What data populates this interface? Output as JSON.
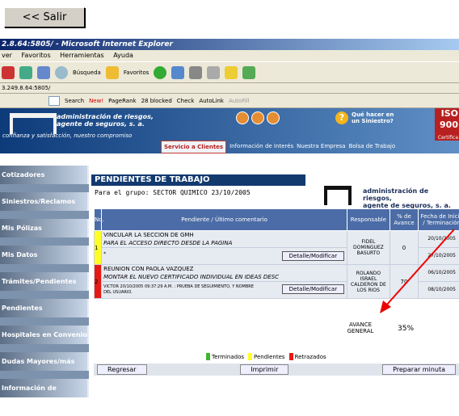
{
  "exit_button": "<< Salir",
  "window": {
    "title": "2.8.64:5805/ - Microsoft Internet Explorer",
    "menu": [
      "ver",
      "Favoritos",
      "Herramientas",
      "Ayuda"
    ],
    "toolbar": {
      "search": "Búsqueda",
      "favorites": "Favoritos"
    },
    "address": "3.249.8.64:5805/",
    "google": {
      "search": "Search",
      "new": "New!",
      "pagerank": "PageRank",
      "blocked": "28 blocked",
      "check": "Check",
      "autolink": "AutoLink",
      "autofill": "AutoFill"
    }
  },
  "site": {
    "brand_line1": "administración de riesgos,",
    "brand_line2": "agente de seguros, s. a.",
    "tagline": "confianza y satisfacción, nuestro compromiso",
    "help_line1": "Qué hacer en",
    "help_line2": "un Siniestro?",
    "iso_line1": "ISO",
    "iso_line2": "900",
    "iso_line3": "Certifica",
    "nav": [
      "Servicio a Clientes",
      "Información de Interés",
      "Nuestra Empresa",
      "Bolsa de Trabajo"
    ]
  },
  "sidebar": [
    "Cotizadores",
    "Siniestros/Reclamos",
    "Mis Pólizas",
    "Mis Datos",
    "Trámites/Pendientes",
    "Pendientes",
    "Hospitales en Convenio",
    "Dudas Mayores/más",
    "Información de Seguros"
  ],
  "page": {
    "title": "PENDIENTES DE TRABAJO",
    "group": "Para el grupo: SECTOR QUIMICO  23/10/2005",
    "logo_line1": "administración de riesgos,",
    "logo_line2": "agente de seguros, s. a."
  },
  "table": {
    "headers": [
      "No.",
      "Pendiente / Último comentario",
      "Responsable",
      "% de Avance",
      "Fecha de Inicio / Terminación"
    ],
    "rows": [
      {
        "num": "1",
        "status_color": "#ffff26",
        "pending": "VINCULAR LA SECCION DE GMH",
        "comment": "PARA EL ACCESO DIRECTO DESDE LA PAGINA",
        "extra": "*",
        "button": "Detalle/Modificar",
        "resp": "FIDEL DOMINGUEZ BASURTO",
        "pct": "0",
        "start": "20/10/2005",
        "end": "27/10/2005"
      },
      {
        "num": "2",
        "status_color": "#e41b14",
        "pending": "REUNION CON PAOLA VAZQUEZ",
        "comment": "MONTAR EL NUEVO CERTIFICADO INDIVIDUAL EN IDEAS DESC",
        "extra": "VICTOR 20/10/2005 09:37:29 A.M. : PRUEBA DE SEGUIMIENTO, Y NOMBRE DEL USUARIO.",
        "button": "Detalle/Modificar",
        "resp": "ROLANDO ISRAEL CALDERON DE LOS RIOS",
        "pct": "70",
        "start": "06/10/2005",
        "end": "08/10/2005"
      }
    ]
  },
  "avance": {
    "label_line1": "AVANCE",
    "label_line2": "GENERAL",
    "value": "35%"
  },
  "legend": [
    {
      "label": "Terminados",
      "color": "#3cb830"
    },
    {
      "label": "Pendientes",
      "color": "#ffff26"
    },
    {
      "label": "Retrazados",
      "color": "#e41b14"
    }
  ],
  "buttons": {
    "back": "Regresar",
    "print": "Imprimir",
    "prepare": "Preparar minuta"
  }
}
